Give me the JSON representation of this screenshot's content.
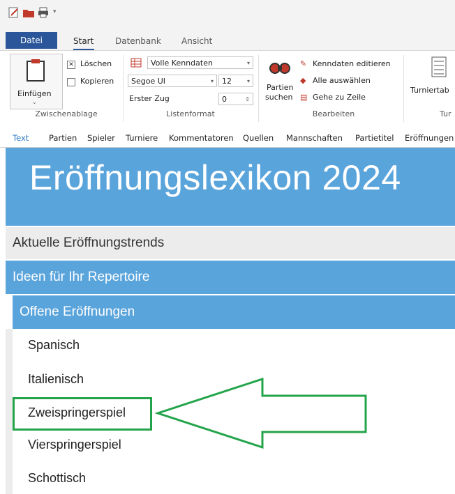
{
  "ribbon": {
    "tabs": {
      "file": "Datei",
      "start": "Start",
      "database": "Datenbank",
      "view": "Ansicht"
    },
    "clipboard": {
      "paste": "Einfügen",
      "delete": "Löschen",
      "copy": "Kopieren",
      "group_label": "Zwischenablage"
    },
    "list_format": {
      "data_select": "Volle Kenndaten",
      "font": "Segoe UI",
      "size": "12",
      "first_move_label": "Erster Zug",
      "first_move_value": "0",
      "group_label": "Listenformat"
    },
    "edit": {
      "search_games_l1": "Partien",
      "search_games_l2": "suchen",
      "edit_data": "Kenndaten editieren",
      "select_all": "Alle auswählen",
      "goto_line": "Gehe zu Zeile",
      "group_label": "Bearbeiten"
    },
    "tournament": {
      "label": "Turniertab",
      "group_label": "Tur"
    }
  },
  "nav": [
    "Text",
    "Partien",
    "Spieler",
    "Turniere",
    "Kommentatoren",
    "Quellen",
    "Mannschaften",
    "Partietitel",
    "Eröffnungen"
  ],
  "content": {
    "title": "Eröffnungslexikon 2024",
    "section1": "Aktuelle Eröffnungstrends",
    "section2": "Ideen für Ihr Repertoire",
    "subsection": "Offene Eröffnungen",
    "items": [
      "Spanisch",
      "Italienisch",
      "Zweispringerspiel",
      "Vierspringerspiel",
      "Schottisch"
    ]
  },
  "colors": {
    "accent": "#5aa4dc",
    "highlight": "#23a44a",
    "file_tab": "#2b579a"
  }
}
